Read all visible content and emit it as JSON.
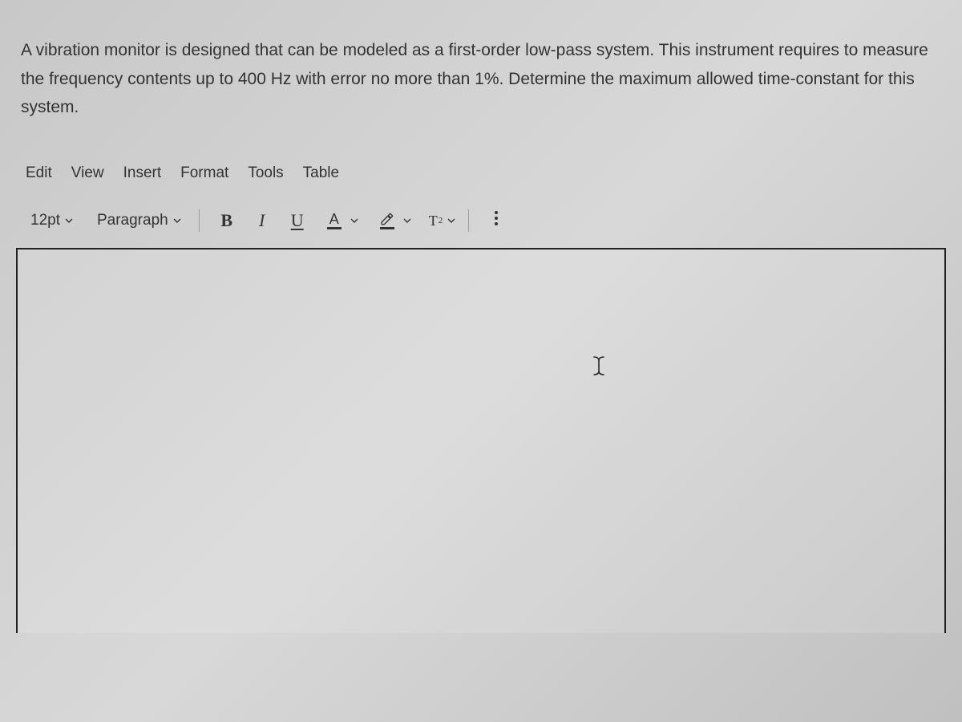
{
  "question": {
    "text": "A vibration monitor is designed that can be modeled as a first-order low-pass system. This instrument requires to measure the frequency contents up to 400 Hz with error no more than 1%. Determine the maximum allowed time-constant for this system."
  },
  "menubar": {
    "items": [
      "Edit",
      "View",
      "Insert",
      "Format",
      "Tools",
      "Table"
    ]
  },
  "toolbar": {
    "font_size": "12pt",
    "block_format": "Paragraph",
    "bold_label": "B",
    "italic_label": "I",
    "underline_label": "U",
    "text_color_letter": "A",
    "superscript_base": "T",
    "superscript_sup": "2"
  }
}
